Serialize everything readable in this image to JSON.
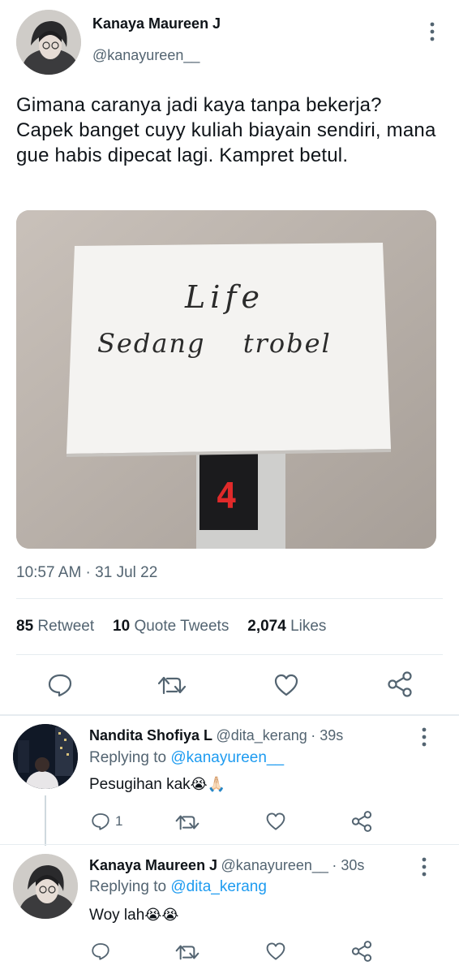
{
  "main_tweet": {
    "author_name": "Kanaya Maureen J",
    "author_handle": "@kanayureen__",
    "text": "Gimana caranya jadi kaya tanpa bekerja? Capek banget cuyy kuliah biayain sendiri, mana gue habis dipecat lagi. Kampret betul.",
    "photo": {
      "note_line1": "Life",
      "note_line2": "Sedang trobel",
      "floor_number": "4"
    },
    "timestamp": "10:57 AM · 31 Jul 22",
    "stats": {
      "retweets_count": "85",
      "retweets_label": "Retweet",
      "quotes_count": "10",
      "quotes_label": "Quote Tweets",
      "likes_count": "2,074",
      "likes_label": "Likes"
    },
    "actions": [
      "reply-icon",
      "retweet-icon",
      "like-icon",
      "share-icon"
    ]
  },
  "replies": [
    {
      "author_name": "Nandita Shofiya L",
      "author_handle": "@dita_kerang",
      "time": "· 39s",
      "replying_prefix": "Replying to",
      "replying_to": "@kanayureen__",
      "text": "Pesugihan kak",
      "emoji": "😭🙏🏻",
      "reply_count": "1"
    },
    {
      "author_name": "Kanaya Maureen J",
      "author_handle": "@kanayureen__",
      "time": "· 30s",
      "replying_prefix": "Replying to",
      "replying_to": "@dita_kerang",
      "text": "Woy lah",
      "emoji": "😭😭",
      "reply_count": ""
    }
  ],
  "colors": {
    "accent": "#1d9bf0",
    "muted": "#536471",
    "divider": "#e6ecf0"
  }
}
